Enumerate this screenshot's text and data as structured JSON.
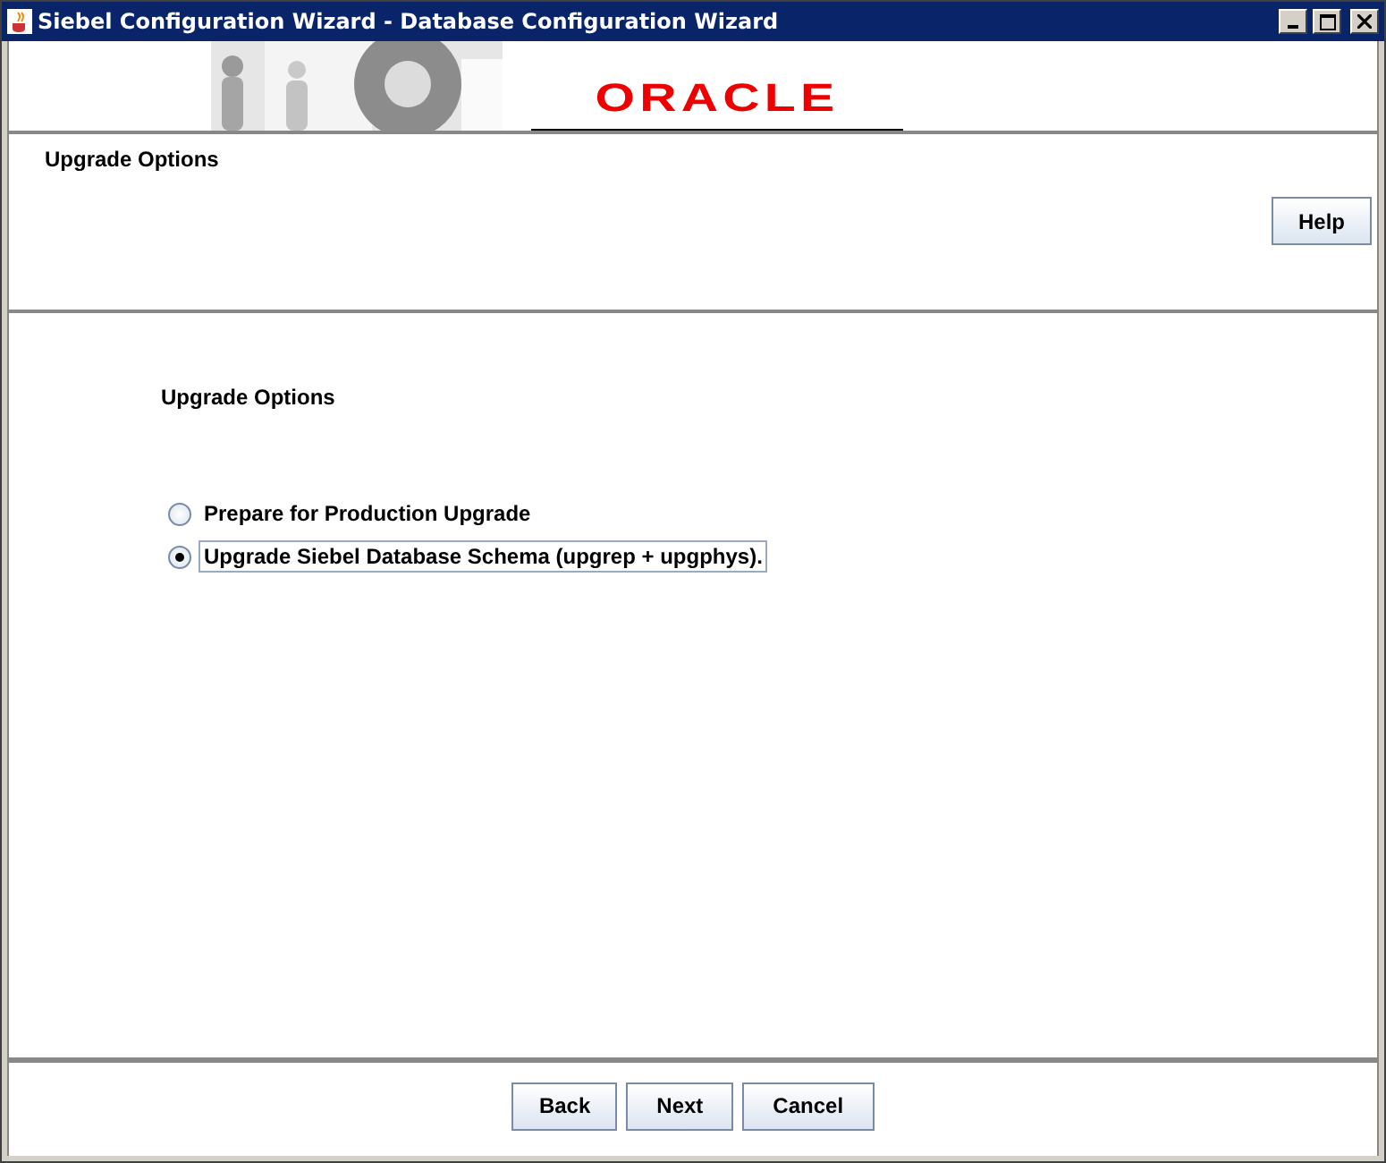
{
  "window": {
    "title": "Siebel Configuration Wizard - Database Configuration Wizard"
  },
  "banner": {
    "logo": "ORACLE"
  },
  "header": {
    "title": "Upgrade Options",
    "help_button": "Help"
  },
  "content": {
    "heading": "Upgrade Options",
    "options": [
      {
        "label": "Prepare for Production Upgrade",
        "selected": false
      },
      {
        "label": "Upgrade Siebel Database Schema (upgrep + upgphys).",
        "selected": true
      }
    ]
  },
  "buttons": [
    "Back",
    "Next",
    "Cancel"
  ]
}
